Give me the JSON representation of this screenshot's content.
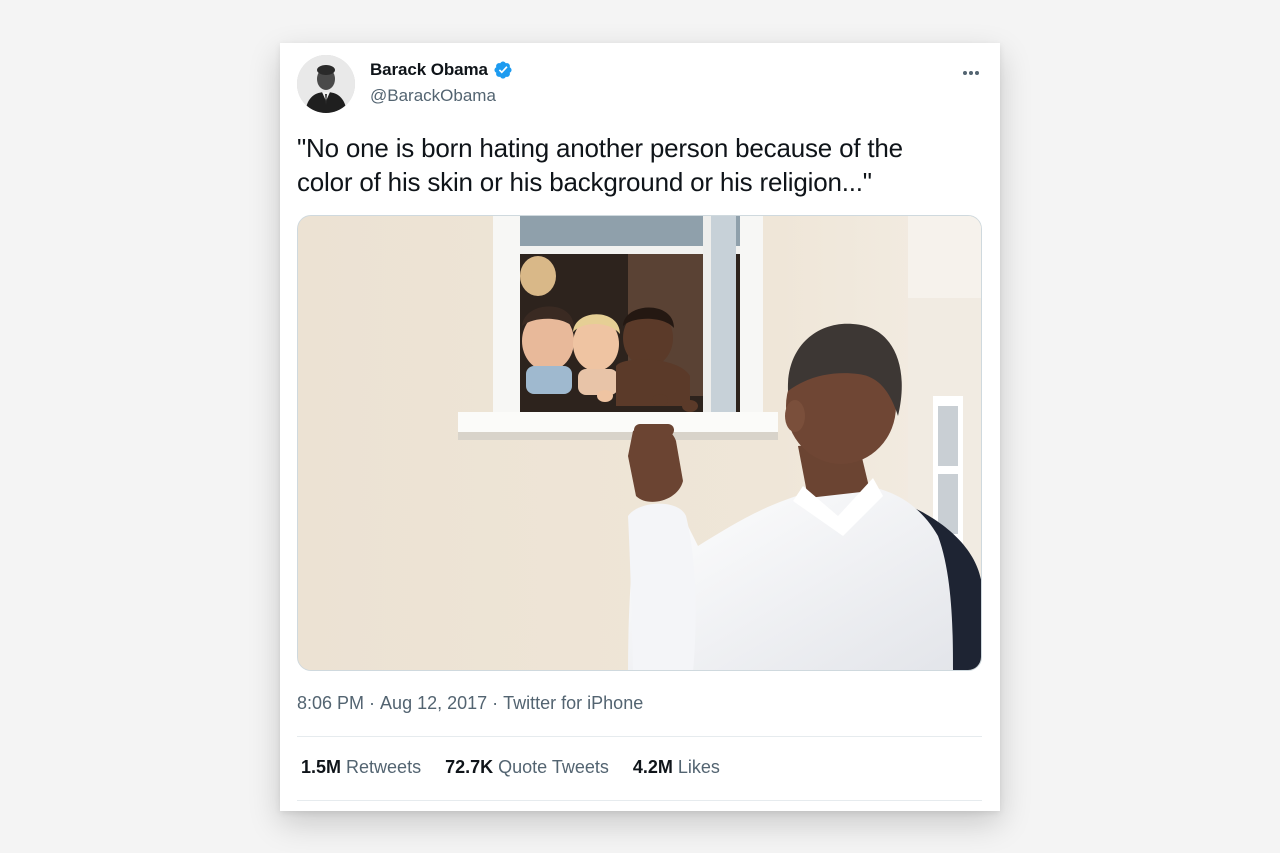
{
  "tweet": {
    "author": {
      "name": "Barack Obama",
      "handle": "@BarackObama",
      "verified": true
    },
    "text": "\"No one is born hating another person because of the\ncolor of his skin or his background or his religion...\"",
    "time": "8:06 PM",
    "date": "Aug 12, 2017",
    "source": "Twitter for iPhone",
    "separator": "·",
    "stats": {
      "retweets": {
        "count": "1.5M",
        "label": "Retweets"
      },
      "quotes": {
        "count": "72.7K",
        "label": "Quote Tweets"
      },
      "likes": {
        "count": "4.2M",
        "label": "Likes"
      }
    }
  },
  "icons": {
    "more": "more-horizontal-icon",
    "verified": "verified-badge-icon"
  },
  "colors": {
    "verified_blue": "#1d9bf0",
    "text_primary": "#0f1419",
    "text_secondary": "#536471"
  }
}
